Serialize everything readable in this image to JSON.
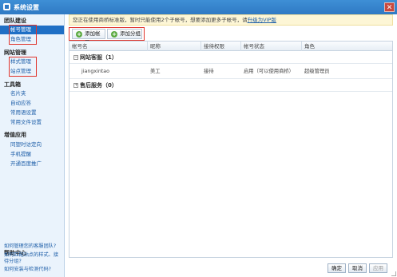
{
  "window": {
    "title": "系统设置",
    "close_glyph": "✕"
  },
  "sidebar": {
    "groups": [
      {
        "title": "团队建设",
        "items": [
          "帐号管理",
          "角色管理"
        ]
      },
      {
        "title": "网站管理",
        "items": [
          "样式管理",
          "站点管理"
        ]
      },
      {
        "title": "工具箱",
        "items": [
          "名片夹",
          "自动应答",
          "常用语设置",
          "常用文件设置"
        ]
      },
      {
        "title": "增值应用",
        "items": [
          "同塑时访定向",
          "手机提醒",
          "开通百度推广"
        ]
      }
    ],
    "active_item": "帐号管理",
    "help": {
      "title": "帮助中心",
      "links": [
        "如何管理您的客服团队?",
        "如何匹配站点的样式、接待分组?",
        "如何安装与检测代码?"
      ]
    }
  },
  "notice": {
    "text": "您正在使用商桥标准版，暂时只能使用2个子帐号，想要添加更多子帐号，请",
    "link": "升级为VIP版"
  },
  "toolbar": {
    "add_account": "添加帐号",
    "add_group": "添加分组",
    "plus_glyph": "+"
  },
  "table": {
    "columns": [
      "帐号名",
      "昵称",
      "接待权限",
      "帐号状态",
      "角色"
    ],
    "groups": [
      {
        "name": "网站客服（1）",
        "toggle": "−",
        "rows": [
          {
            "account": "jiangxintao",
            "nickname": "美工",
            "permission": "接待",
            "status": "启用（可以使用商桥）",
            "role": "超级管理员"
          }
        ]
      },
      {
        "name": "售后服务（0）",
        "toggle": "+",
        "rows": []
      }
    ]
  },
  "footer": {
    "ok": "确定",
    "cancel": "取消",
    "apply": "应用"
  },
  "colors": {
    "titlebar": "#2f79c4",
    "active": "#1f6fc5",
    "highlight_box": "#e0342b"
  }
}
